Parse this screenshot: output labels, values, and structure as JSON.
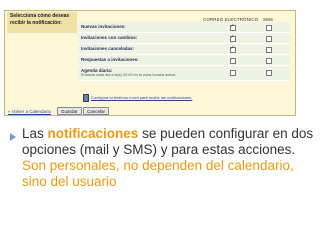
{
  "panel": {
    "select_title": "Selecciona cómo deseas recibir la notificación:",
    "col_email": "CORREO ELECTRÓNICO",
    "col_sms": "SMS",
    "rows": [
      {
        "label": "Nuevas invitaciones:",
        "sub": "",
        "email": true,
        "sms": false
      },
      {
        "label": "Invitaciones con cambios:",
        "sub": "",
        "email": true,
        "sms": false
      },
      {
        "label": "Invitaciones canceladas:",
        "sub": "",
        "email": true,
        "sms": false
      },
      {
        "label": "Respuestas a invitaciones:",
        "sub": "",
        "email": false,
        "sms": false
      },
      {
        "label": "Agenda diaria:",
        "sub": "Enviada cada día a la(s) 00:00 en tu zona horaria actual",
        "email": false,
        "sms": false
      }
    ],
    "phone_link": "Configura tu teléfono móvil para recibir las notificaciones.",
    "back_link": "« Volver a Calendario",
    "save_label": "Guardar",
    "cancel_label": "Cancelar",
    "icons": {
      "phone": "mobile-phone-icon"
    }
  },
  "bullet": {
    "part1": "Las ",
    "highlight": "notificaciones",
    "part2": " se pueden configurar en dos opciones (mail y SMS) y para estas acciones.",
    "part3": " Son personales,  no dependen del calendario, sino del usuario"
  },
  "colors": {
    "accent": "#e89a18",
    "bullet_arrow": "#7a9bc4"
  }
}
